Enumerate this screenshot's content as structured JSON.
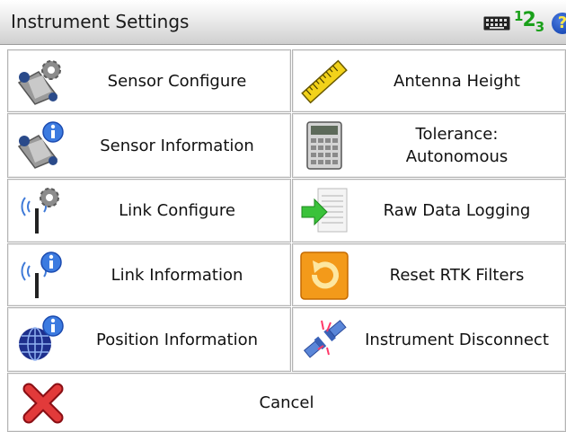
{
  "window": {
    "title": "Instrument Settings",
    "status_icons": [
      "keyboard-icon",
      "numeric-input-icon",
      "help-icon"
    ],
    "input_mode_text": "123",
    "help_glyph": "?"
  },
  "menu": {
    "left": [
      {
        "label": "Sensor Configure",
        "icon": "sensor-configure-icon"
      },
      {
        "label": "Sensor Information",
        "icon": "sensor-information-icon"
      },
      {
        "label": "Link Configure",
        "icon": "link-configure-icon"
      },
      {
        "label": "Link Information",
        "icon": "link-information-icon"
      },
      {
        "label": "Position Information",
        "icon": "position-information-icon"
      }
    ],
    "right": [
      {
        "label": "Antenna Height",
        "icon": "measuring-tape-icon"
      },
      {
        "label": "Tolerance:\nAutonomous",
        "icon": "calculator-icon"
      },
      {
        "label": "Raw Data Logging",
        "icon": "data-logging-icon"
      },
      {
        "label": "Reset RTK Filters",
        "icon": "reset-icon"
      },
      {
        "label": "Instrument Disconnect",
        "icon": "disconnect-icon"
      }
    ],
    "cancel": {
      "label": "Cancel",
      "icon": "cancel-x-icon"
    }
  },
  "colors": {
    "accent_green": "#1aa01a",
    "help_blue": "#0b3aa8",
    "cancel_red": "#d8202a",
    "reset_orange": "#f39a1a"
  }
}
